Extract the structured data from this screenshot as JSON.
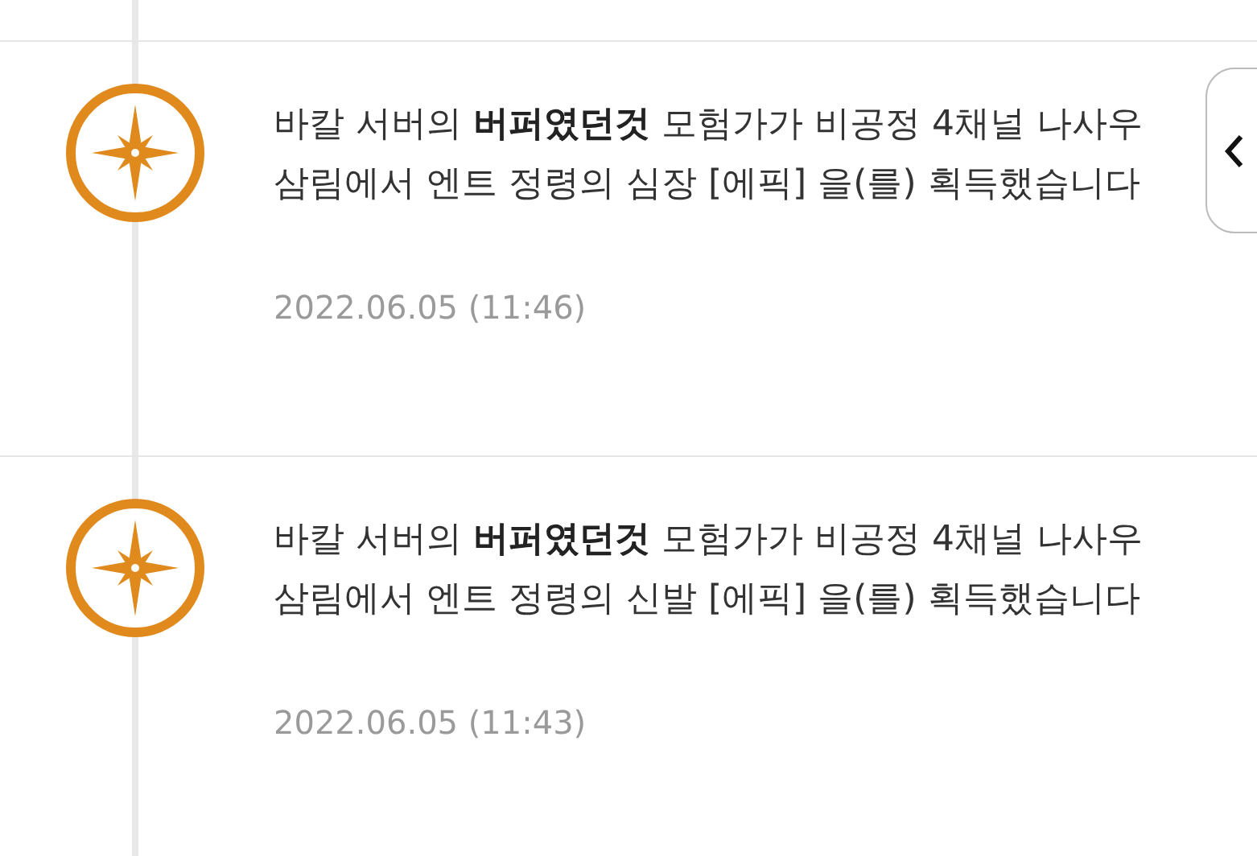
{
  "entries": [
    {
      "message": "바칼 서버의 **버퍼였던것** 모험가가 비공정 4채널 나사우 삼림에서 엔트 정령의 심장 [에픽] 을(를) 획득했습니다",
      "date": "2022.06.05 (11:46)"
    },
    {
      "message": "바칼 서버의 **버퍼였던것** 모험가가 비공정 4채널 나사우 삼림에서 엔트 정령의 신발 [에픽] 을(를) 획득했습니다",
      "date": "2022.06.05 (11:43)"
    }
  ],
  "side_tab": {
    "kind": "collapse"
  }
}
